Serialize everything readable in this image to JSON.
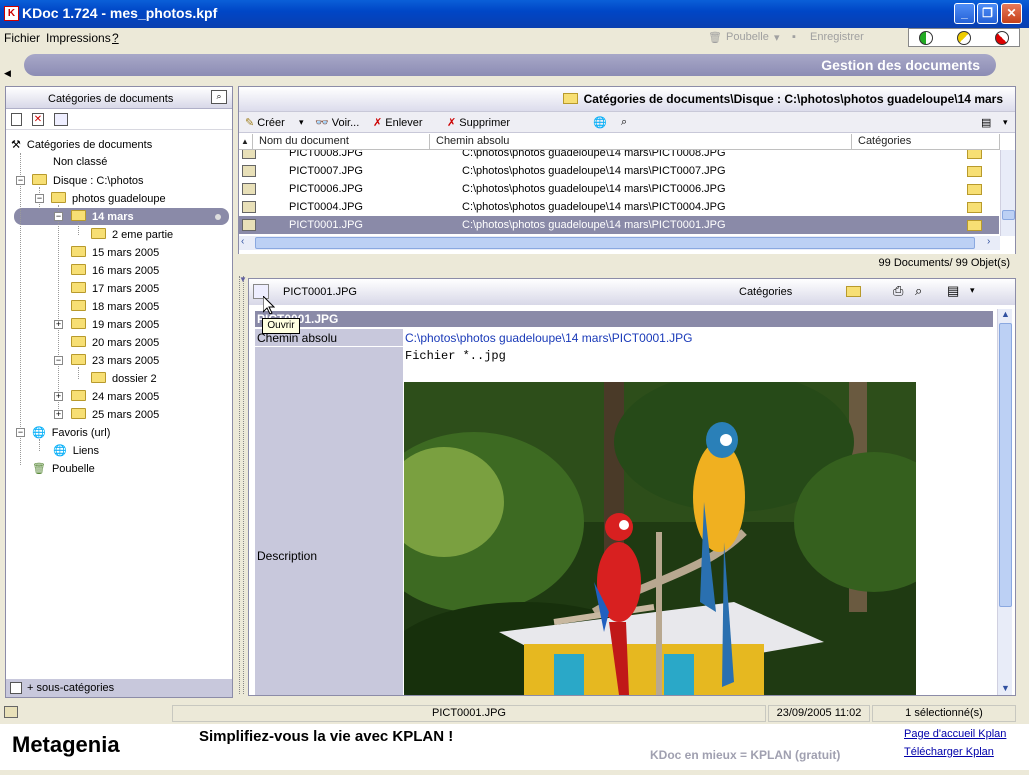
{
  "window": {
    "title": "KDoc  1.724 - mes_photos.kpf",
    "app_icon": "K"
  },
  "menu": {
    "file": "Fichier",
    "print": "Impressions",
    "help": "?"
  },
  "toolbar": {
    "trash": "Poubelle",
    "save": "Enregistrer"
  },
  "banner": {
    "title": "Gestion des documents"
  },
  "left_panel": {
    "title": "Catégories de documents",
    "tree": [
      "Catégories de documents",
      "Non classé",
      "Disque : C:\\photos",
      "photos guadeloupe",
      "14 mars",
      "2 eme partie",
      "15 mars 2005",
      "16 mars 2005",
      "17 mars 2005",
      "18 mars 2005",
      "19 mars 2005",
      "20 mars 2005",
      "23 mars 2005",
      "dossier 2",
      "24 mars 2005",
      "25 mars 2005",
      "Favoris (url)",
      "Liens",
      "Poubelle"
    ],
    "footer": "+ sous-catégories"
  },
  "right_panel": {
    "path": "Catégories de documents\\Disque : C:\\photos\\photos guadeloupe\\14 mars",
    "tools": {
      "create": "Créer",
      "view": "Voir...",
      "remove": "Enlever",
      "delete": "Supprimer"
    },
    "columns": [
      "Nom du document",
      "Chemin absolu",
      "Catégories"
    ],
    "rows": [
      {
        "name": "PICT0008.JPG",
        "path": "C:\\photos\\photos guadeloupe\\14 mars\\PICT0008.JPG"
      },
      {
        "name": "PICT0007.JPG",
        "path": "C:\\photos\\photos guadeloupe\\14 mars\\PICT0007.JPG"
      },
      {
        "name": "PICT0006.JPG",
        "path": "C:\\photos\\photos guadeloupe\\14 mars\\PICT0006.JPG"
      },
      {
        "name": "PICT0004.JPG",
        "path": "C:\\photos\\photos guadeloupe\\14 mars\\PICT0004.JPG"
      },
      {
        "name": "PICT0001.JPG",
        "path": "C:\\photos\\photos guadeloupe\\14 mars\\PICT0001.JPG"
      }
    ],
    "count": "99 Documents/ 99 Objet(s)"
  },
  "detail": {
    "file": "PICT0001.JPG",
    "categories_label": "Catégories",
    "title": "PICT0001.JPG",
    "tooltip": "Ouvrir",
    "path_label": "Chemin absolu",
    "path_value": "C:\\photos\\photos guadeloupe\\14 mars\\PICT0001.JPG",
    "desc_label": "Description",
    "desc_text": "Fichier *..jpg"
  },
  "statusbar": {
    "file": "PICT0001.JPG",
    "datetime": "23/09/2005 11:02",
    "selected": "1 sélectionné(s)"
  },
  "footer": {
    "brand": "Metagenia",
    "slogan": "Simplifiez-vous la vie avec KPLAN !",
    "tagline": "KDoc en mieux = KPLAN (gratuit)",
    "link1": "Page d'accueil Kplan",
    "link2": "Télécharger Kplan"
  }
}
